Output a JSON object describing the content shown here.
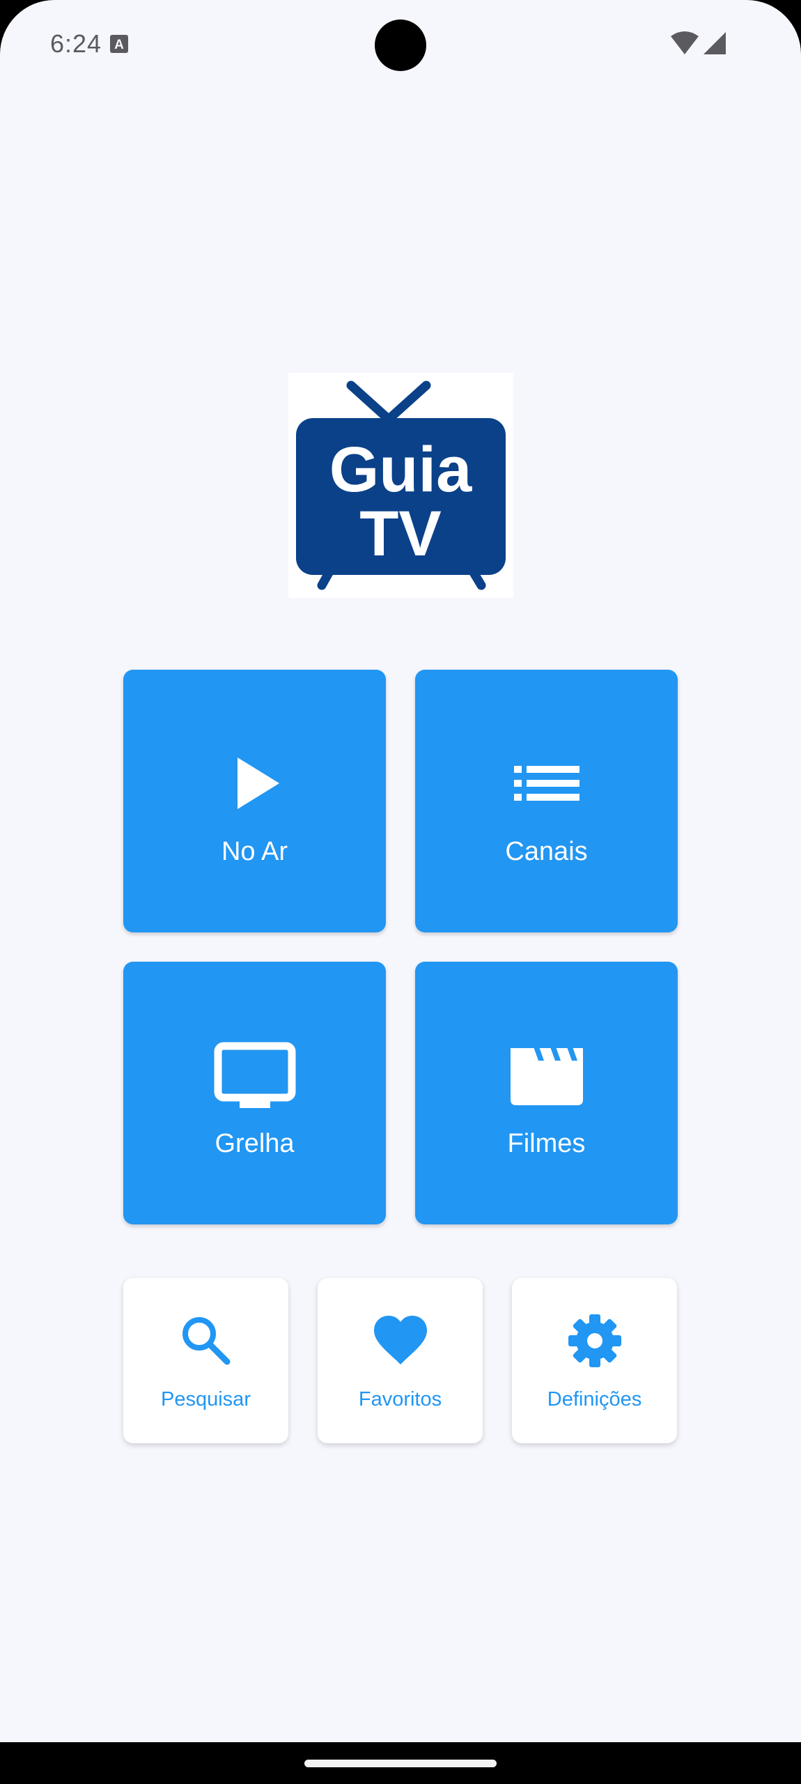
{
  "status_bar": {
    "time": "6:24",
    "a_icon_glyph": "A"
  },
  "logo": {
    "line1": "Guia",
    "line2": "TV",
    "color": "#0b4189"
  },
  "tiles": [
    {
      "label": "No Ar",
      "icon": "play-icon"
    },
    {
      "label": "Canais",
      "icon": "list-icon"
    },
    {
      "label": "Grelha",
      "icon": "tv-icon"
    },
    {
      "label": "Filmes",
      "icon": "clapperboard-icon"
    }
  ],
  "cards": [
    {
      "label": "Pesquisar",
      "icon": "search-icon"
    },
    {
      "label": "Favoritos",
      "icon": "heart-icon"
    },
    {
      "label": "Definições",
      "icon": "gear-icon"
    }
  ],
  "colors": {
    "accent": "#2196f3",
    "background": "#f6f7fd",
    "logo_blue": "#0b4189"
  }
}
